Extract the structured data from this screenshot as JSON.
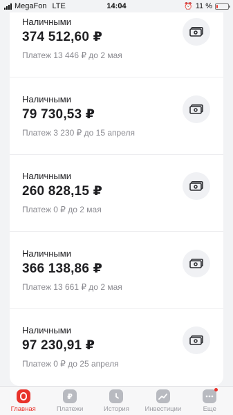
{
  "status_bar": {
    "carrier": "MegaFon",
    "network": "LTE",
    "time": "14:04",
    "battery": "11 %",
    "battery_level": 0.11,
    "battery_color": "#e5352b"
  },
  "loans": [
    {
      "type": "Наличными",
      "amount": "374 512,60 ₽",
      "note": "Платеж 13 446 ₽ до 2 мая",
      "icon": "cash-icon"
    },
    {
      "type": "Наличными",
      "amount": "79 730,53 ₽",
      "note": "Платеж 3 230 ₽ до 15 апреля",
      "icon": "cash-icon"
    },
    {
      "type": "Наличными",
      "amount": "260 828,15 ₽",
      "note": "Платеж 0 ₽ до 2 мая",
      "icon": "cash-icon"
    },
    {
      "type": "Наличными",
      "amount": "366 138,86 ₽",
      "note": "Платеж 13 661 ₽ до 2 мая",
      "icon": "cash-icon"
    },
    {
      "type": "Наличными",
      "amount": "97 230,91 ₽",
      "note": "Платеж 0 ₽ до 25 апреля",
      "icon": "cash-icon"
    }
  ],
  "tab_bar": {
    "accent_color": "#e8322b",
    "tabs": [
      {
        "label": "Главная",
        "icon": "home-icon",
        "active": true
      },
      {
        "label": "Платежи",
        "icon": "ruble-icon",
        "active": false
      },
      {
        "label": "История",
        "icon": "clock-icon",
        "active": false
      },
      {
        "label": "Инвестиции",
        "icon": "chart-icon",
        "active": false
      },
      {
        "label": "Еще",
        "icon": "more-icon",
        "active": false,
        "badge": true
      }
    ]
  }
}
